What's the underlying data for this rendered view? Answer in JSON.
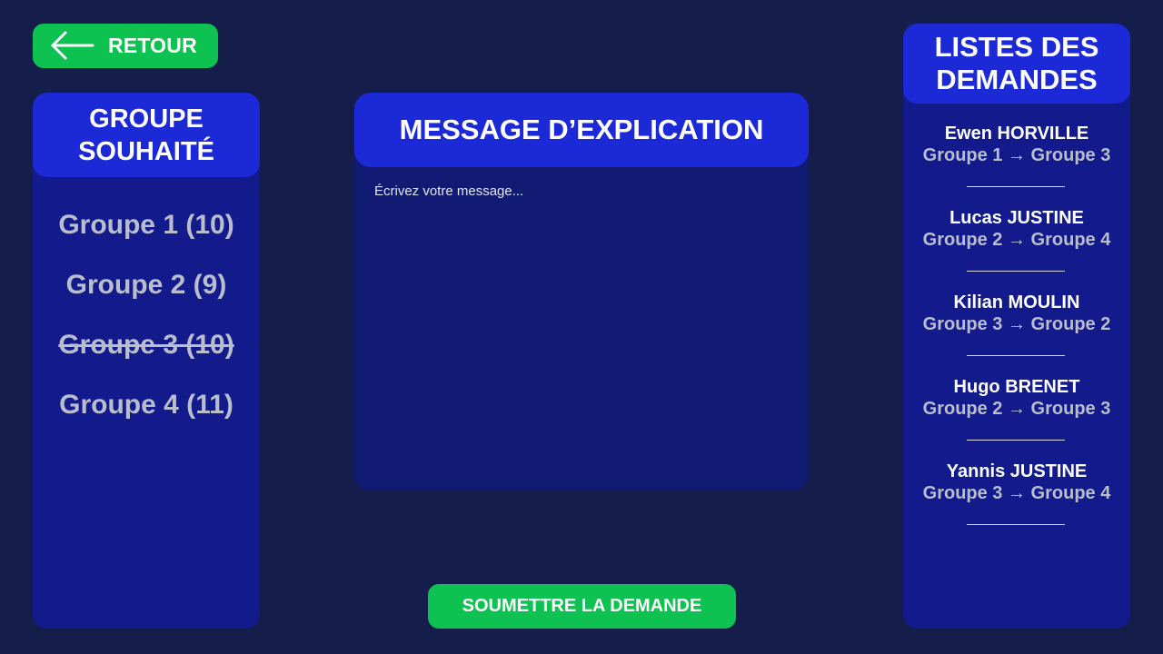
{
  "nav": {
    "back_label": "RETOUR"
  },
  "groups_panel": {
    "title": "GROUPE SOUHAITÉ",
    "items": [
      {
        "label": "Groupe 1 (10)",
        "available": true
      },
      {
        "label": "Groupe 2 (9)",
        "available": true
      },
      {
        "label": "Groupe 3 (10)",
        "available": false
      },
      {
        "label": "Groupe 4 (11)",
        "available": true
      }
    ]
  },
  "message_panel": {
    "title": "MESSAGE D’EXPLICATION",
    "placeholder": "Écrivez votre message...",
    "value": ""
  },
  "submit": {
    "label": "SOUMETTRE LA DEMANDE"
  },
  "requests_panel": {
    "title": "LISTES DES DEMANDES",
    "items": [
      {
        "name": "Ewen HORVILLE",
        "move": "Groupe 1 → Groupe 3"
      },
      {
        "name": "Lucas JUSTINE",
        "move": "Groupe 2 → Groupe 4"
      },
      {
        "name": "Kilian MOULIN",
        "move": "Groupe 3 → Groupe 2"
      },
      {
        "name": "Hugo BRENET",
        "move": "Groupe 2 → Groupe 3"
      },
      {
        "name": "Yannis JUSTINE",
        "move": "Groupe 3 → Groupe 4"
      }
    ]
  },
  "colors": {
    "background": "#151e4a",
    "panel": "#131b8c",
    "panel_header": "#1b2ad6",
    "accent_green": "#0ec252",
    "muted_text": "#b9bdcc"
  },
  "icons": {
    "back": "arrow-left-icon"
  }
}
